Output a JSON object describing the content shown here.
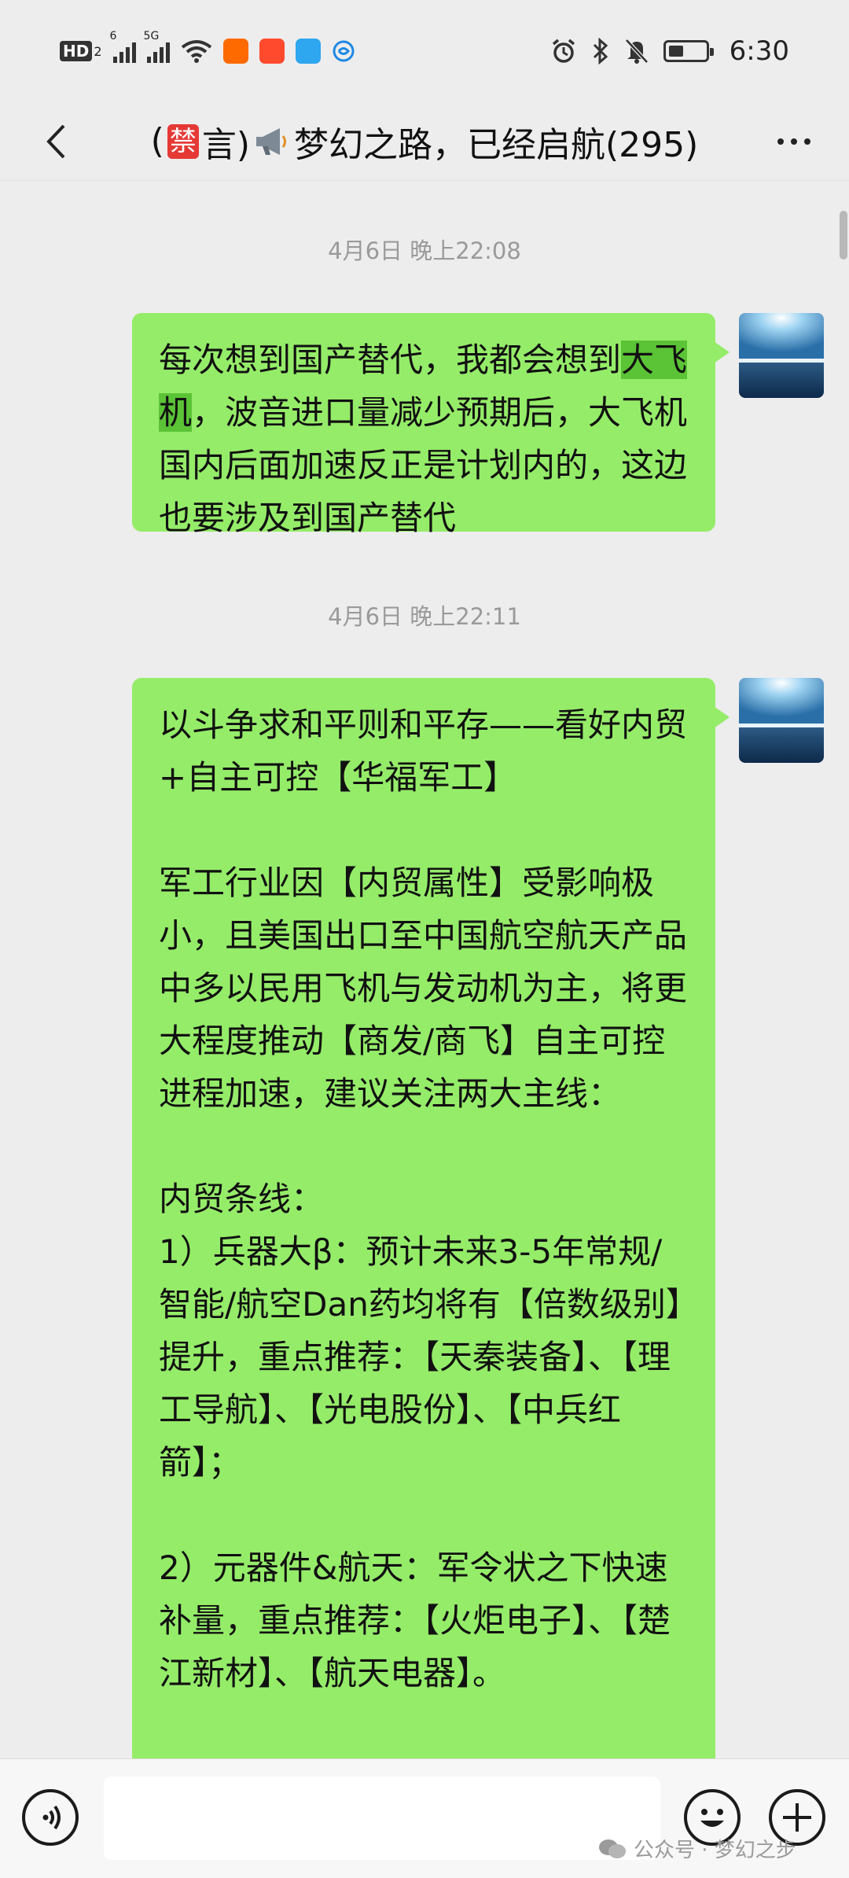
{
  "status_bar": {
    "hd_label": "HD",
    "hd_sub": "2",
    "signal1_label": "6",
    "signal2_label": "5G",
    "time": "6:30"
  },
  "header": {
    "title_open": "(",
    "ban_char": "禁",
    "title_mid": "言)",
    "title_name": "梦幻之路，已经启航(295)"
  },
  "messages": [
    {
      "timestamp": "4月6日 晚上22:08",
      "text_pre": "每次想到国产替代，我都会想到",
      "text_hl": "大飞机",
      "text_post": "，波音进口量减少预期后，大飞机国内后面加速反正是计划内的，这边也要涉及到国产替代"
    },
    {
      "timestamp": "4月6日 晚上22:11",
      "text": "以斗争求和平则和平存——看好内贸+自主可控【华福军工】\n\n军工行业因【内贸属性】受影响极小，且美国出口至中国航空航天产品中多以民用飞机与发动机为主，将更大程度推动【商发/商飞】自主可控进程加速，建议关注两大主线：\n\n内贸条线：\n1）兵器大β：预计未来3-5年常规/智能/航空Dan药均将有【倍数级别】提升，重点推荐：【天秦装备】、【理工导航】、【光电股份】、【中兵红箭】；\n\n2）元器件&航天：军令状之下快速补量，重点推荐：【火炬电子】、【楚江新材】、【航天电器】。"
    }
  ],
  "watermark": "公众号 · 梦幻之步",
  "colors": {
    "bubble": "#95ec69",
    "highlight": "#5bc336",
    "background": "#ededed",
    "ban_badge": "#e53935"
  },
  "icons": [
    "back-chevron-icon",
    "more-dots-icon",
    "voice-icon",
    "emoji-icon",
    "plus-icon",
    "wifi-icon",
    "alarm-icon",
    "bluetooth-icon",
    "mute-bell-icon",
    "battery-icon"
  ]
}
